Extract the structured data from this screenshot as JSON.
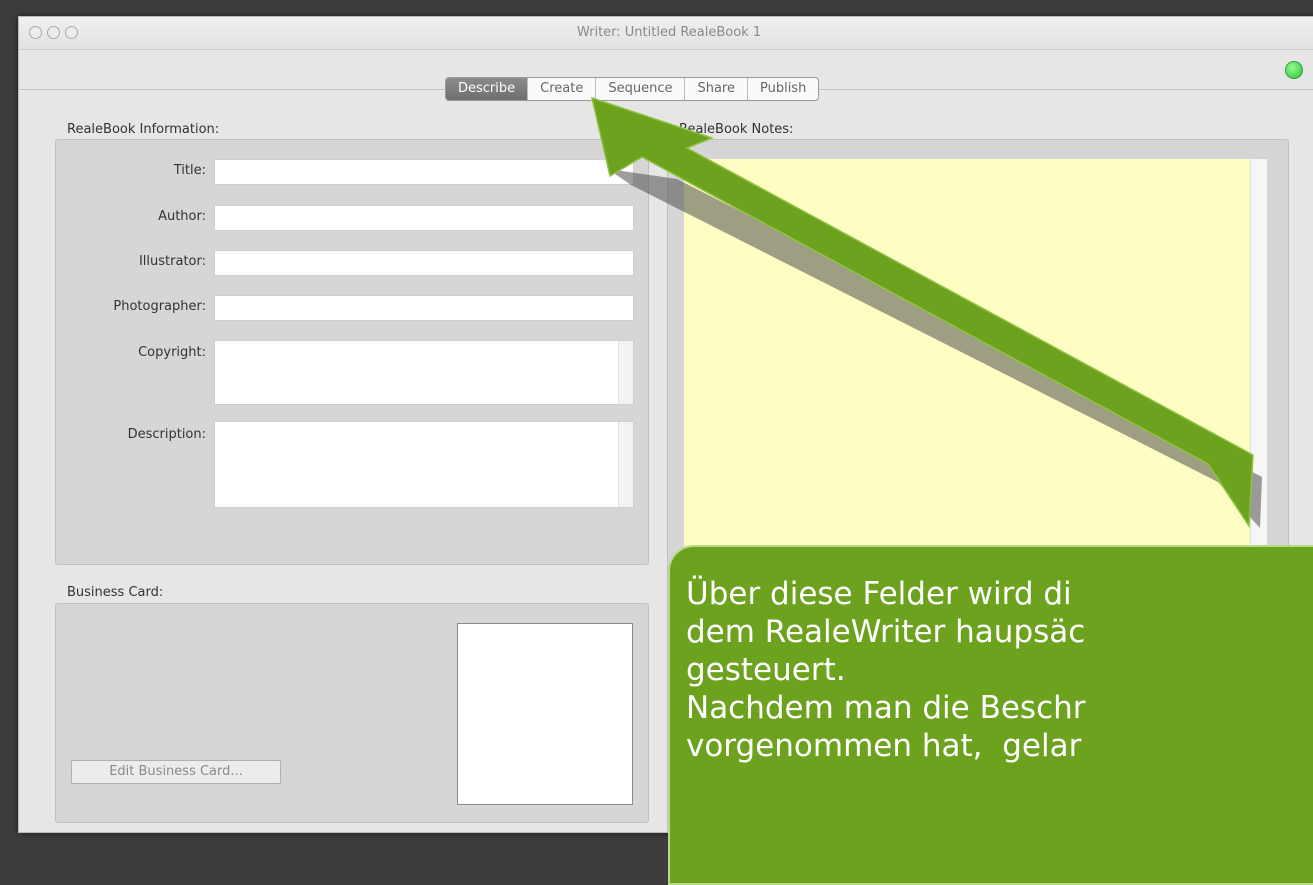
{
  "window": {
    "title": "Writer: Untitled RealeBook 1"
  },
  "tabs": [
    {
      "label": "Describe",
      "active": true
    },
    {
      "label": "Create",
      "active": false
    },
    {
      "label": "Sequence",
      "active": false
    },
    {
      "label": "Share",
      "active": false
    },
    {
      "label": "Publish",
      "active": false
    }
  ],
  "info": {
    "heading": "RealeBook Information:",
    "fields": {
      "title": {
        "label": "Title:",
        "value": ""
      },
      "author": {
        "label": "Author:",
        "value": ""
      },
      "illustrator": {
        "label": "Illustrator:",
        "value": ""
      },
      "photographer": {
        "label": "Photographer:",
        "value": ""
      },
      "copyright": {
        "label": "Copyright:",
        "value": ""
      },
      "description": {
        "label": "Description:",
        "value": ""
      }
    }
  },
  "notes": {
    "heading": "RealeBook Notes:",
    "value": ""
  },
  "business_card": {
    "heading": "Business Card:",
    "edit_button": "Edit Business Card..."
  },
  "callout": {
    "text": "Über diese Felder wird di\ndem RealeWriter haupsäc\ngesteuert.\nNachdem man die Beschr\nvorgenommen hat,  gelar"
  },
  "colors": {
    "accent_green": "#6ca21d",
    "notes_yellow": "#fffec2",
    "status_green": "#2fbf2f"
  }
}
